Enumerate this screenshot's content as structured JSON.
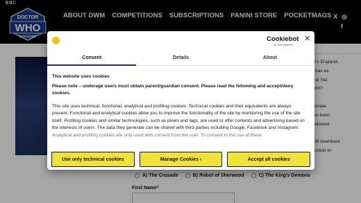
{
  "header": {
    "bbc": "BBC",
    "nav": [
      "ABOUT DWM",
      "COMPETITIONS",
      "SUBSCRIPTIONS",
      "PANINI STORE",
      "POCKETMAGS"
    ],
    "social": [
      "X",
      "◎",
      "f"
    ]
  },
  "logo": {
    "line1": "DOCTOR",
    "line2": "WHO",
    "line3": "MAGAZINE"
  },
  "page": {
    "side_text": [
      "'t's England,",
      "mas as",
      "nd Yaz",
      "ent?",
      "",
      "timate",
      "as been",
      "allowed",
      "",
      "99 download",
      "estion to"
    ],
    "radios": [
      "A) The Crusade",
      "B) Robot of Sherwood",
      "C) The King's Demons"
    ],
    "first_name_label": "First Name",
    "required_mark": "*"
  },
  "cookie": {
    "brand": "Cookiebot",
    "brand_sub": "by Usercentrics",
    "close": "✕",
    "tabs": [
      "Consent",
      "Details",
      "About"
    ],
    "title": "This website uses cookies",
    "note": "Please note – underage users must obtain parent/guardian consent. Please read the following and accept/deny cookies.",
    "text": "This site uses technical, functional, analytical and profiling cookies. Technical cookies and their equivalents are always present.  Functional and analytical cookies allow you to improve the functionality of the site by monitoring the use of the site itself.  Profiling cookies and similar technologies, such as pixels and tags, are used to offer contents and advertising based on the interests of users.  The data they generate can be shared with third parties including Google, Facebook and Instagram. Analytical and profiling cookies are only used with consent from the user. To consent to the use of these",
    "buttons": [
      "Use only technical cookies",
      "Manage Cookies  ›",
      "Accept all cookies"
    ]
  },
  "colors": {
    "accent": "#f1e13b",
    "tab_active": "#1c2b8c",
    "header_bg": "#000000"
  }
}
